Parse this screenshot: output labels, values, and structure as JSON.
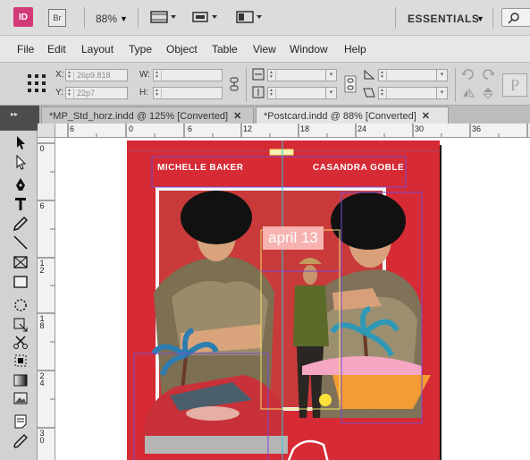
{
  "app": {
    "logo": "ID",
    "bridge_logo": "Br",
    "zoom": "88%",
    "workspace": "ESSENTIALS"
  },
  "menu": [
    "File",
    "Edit",
    "Layout",
    "Type",
    "Object",
    "Table",
    "View",
    "Window",
    "Help"
  ],
  "control_panel": {
    "x_label": "X:",
    "x_value": "26p9.818",
    "y_label": "Y:",
    "y_value": "22p7",
    "w_label": "W:",
    "w_value": "",
    "h_label": "H:",
    "h_value": ""
  },
  "tabs": [
    {
      "label": "*MP_Std_horz.indd @ 125% [Converted]",
      "close": "✕",
      "active": false
    },
    {
      "label": "*Postcard.indd @ 88% [Converted]",
      "close": "✕",
      "active": true
    }
  ],
  "ruler": {
    "h_labels": [
      "6",
      "0",
      "6",
      "12",
      "18",
      "24",
      "30",
      "36"
    ],
    "v_labels": [
      "0",
      "6",
      "12",
      "18",
      "24",
      "30"
    ]
  },
  "document": {
    "name_left": "MICHELLE BAKER",
    "name_right": "CASANDRA GOBLE",
    "date": "april 13",
    "page_color": "#d62a34"
  },
  "colors": {
    "frame_purple": "#7b4bd1",
    "frame_yellow": "#f4e36a",
    "frame_cyan": "#34c7d6",
    "selection_blue": "#3a6df0"
  },
  "tools": [
    "selection-tool-icon",
    "direct-selection-tool-icon",
    "pen-tool-icon",
    "type-tool-icon",
    "pencil-tool-icon",
    "line-tool-icon",
    "rectangle-frame-tool-icon",
    "rectangle-tool-icon",
    "ellipse-tool-icon",
    "free-transform-tool-icon",
    "scissors-tool-icon",
    "gradient-feather-tool-icon",
    "gradient-swatch-tool-icon",
    "note-tool-icon",
    "eyedropper-tool-icon"
  ]
}
